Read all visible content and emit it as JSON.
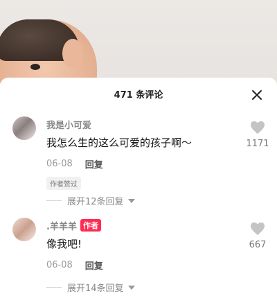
{
  "header": {
    "comment_count_label": "471 条评论"
  },
  "comments": [
    {
      "username": "我是小可爱",
      "text": "我怎么生的这么可爱的孩子啊～",
      "date": "06-08",
      "reply_label": "回复",
      "badge": "作者赞过",
      "likes": "1171",
      "expand_label": "展开12条回复"
    },
    {
      "username": ".羊羊羊",
      "author_tag": "作者",
      "text": "像我吧!",
      "date": "06-08",
      "reply_label": "回复",
      "likes": "667",
      "expand_label": "展开14条回复"
    }
  ],
  "icons": {
    "close": "close-icon",
    "like": "heart-icon",
    "chevron": "chevron-down-icon"
  },
  "colors": {
    "author_tag": "#fe2c55",
    "like_icon": "#c4c4c4"
  }
}
